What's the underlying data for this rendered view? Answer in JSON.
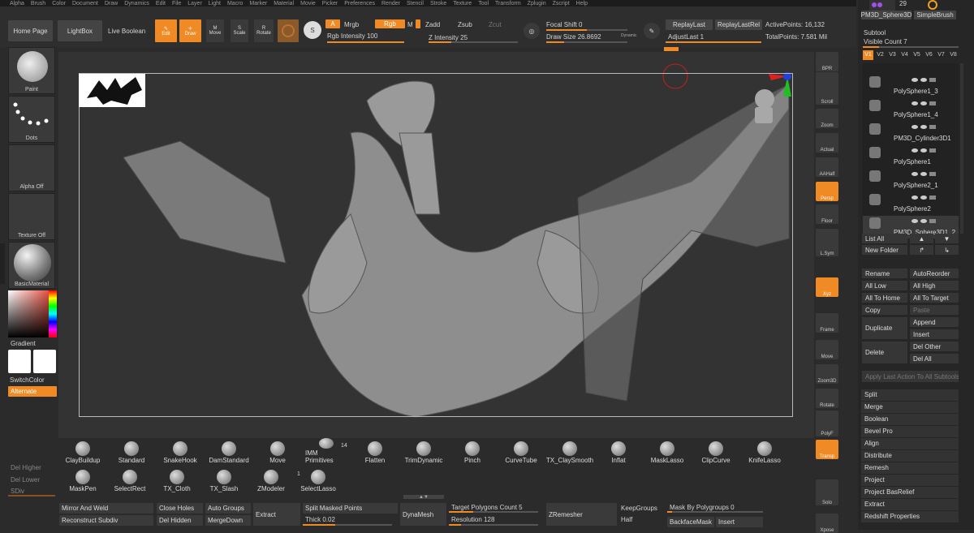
{
  "menu": [
    "Alpha",
    "Brush",
    "Color",
    "Document",
    "Draw",
    "Dynamics",
    "Edit",
    "File",
    "Layer",
    "Light",
    "Macro",
    "Marker",
    "Material",
    "Movie",
    "Picker",
    "Preferences",
    "Render",
    "Stencil",
    "Stroke",
    "Texture",
    "Tool",
    "Transform",
    "Zplugin",
    "Zscript",
    "Help"
  ],
  "top": {
    "home_page": "Home Page",
    "lightbox": "LightBox",
    "live_boolean": "Live Boolean",
    "edit": "Edit",
    "draw": "Draw",
    "move": "Move",
    "scale": "Scale",
    "rotate": "Rotate",
    "a": "A",
    "mrgb": "Mrgb",
    "rgb": "Rgb",
    "m": "M",
    "zadd": "Zadd",
    "zsub": "Zsub",
    "zcut": "Zcut",
    "rgb_intensity_label": "Rgb Intensity",
    "rgb_intensity": "100",
    "z_intensity_label": "Z Intensity",
    "z_intensity": "25",
    "focal_shift_label": "Focal Shift",
    "focal_shift": "0",
    "draw_size_label": "Draw Size",
    "draw_size": "26.8692",
    "dynamic": "Dynamic",
    "replay_last": "ReplayLast",
    "replay_last_rel": "ReplayLastRel",
    "adjust_last_label": "AdjustLast",
    "adjust_last": "1",
    "active_points_label": "ActivePoints:",
    "active_points": "16,132",
    "total_points_label": "TotalPoints:",
    "total_points": "7.581 Mil"
  },
  "left": {
    "paint": "Paint",
    "dots": "Dots",
    "alpha_off": "Alpha Off",
    "texture_off": "Texture Off",
    "basic_material": "BasicMaterial",
    "gradient": "Gradient",
    "switch_color": "SwitchColor",
    "alternate": "Alternate",
    "del_higher": "Del Higher",
    "del_lower": "Del Lower",
    "sdiv": "SDiv"
  },
  "right_strip": [
    "BPR",
    "SPix 3",
    "Scroll",
    "Zoom",
    "Actual",
    "AAHalf",
    "Persp",
    "Floor",
    "Dynamic",
    "L.Sym",
    "Xyz",
    "Frame",
    "Move",
    "Zoom3D",
    "Rotate",
    "Line Fill",
    "PolyF",
    "Transp",
    "Dynamic",
    "Solo",
    "Xpose"
  ],
  "rpanel": {
    "top_count": "29",
    "top_tool": "PM3D_Sphere3D",
    "top_brush": "SimpleBrush",
    "subtool": "Subtool",
    "visible_count_label": "Visible Count",
    "visible_count": "7",
    "versions": [
      "V1",
      "V2",
      "V3",
      "V4",
      "V5",
      "V6",
      "V7",
      "V8"
    ],
    "subtools": [
      "PolySphere1_3",
      "PolySphere1_4",
      "PM3D_Cylinder3D1",
      "PolySphere1",
      "PolySphere2_1",
      "PolySphere2",
      "PM3D_Sphere3D1_2"
    ],
    "list_all": "List All",
    "new_folder": "New Folder",
    "rename": "Rename",
    "auto_reorder": "AutoReorder",
    "all_low": "All Low",
    "all_high": "All High",
    "all_to_home": "All To Home",
    "all_to_target": "All To Target",
    "copy": "Copy",
    "paste": "Paste",
    "duplicate": "Duplicate",
    "append": "Append",
    "insert": "Insert",
    "delete": "Delete",
    "del_other": "Del Other",
    "del_all": "Del All",
    "apply_last": "Apply Last Action To All Subtools",
    "menu": [
      "Split",
      "Merge",
      "Boolean",
      "Bevel Pro",
      "Align",
      "Distribute",
      "Remesh",
      "Project",
      "Project BasRelief",
      "Extract",
      "Redshift Properties"
    ]
  },
  "brushes_row1": [
    "ClayBuildup",
    "Standard",
    "SnakeHook",
    "DamStandard",
    "Move",
    "IMM Primitives",
    "Flatten",
    "TrimDynamic",
    "Pinch",
    "CurveTube",
    "TX_ClaySmooth",
    "Inflat",
    "MaskLasso",
    "ClipCurve",
    "KnifeLasso"
  ],
  "imm_count": "14",
  "brushes_row2": [
    "MaskPen",
    "SelectRect",
    "TX_Cloth",
    "TX_Slash",
    "ZModeler",
    "SelectLasso"
  ],
  "zmodeler_count": "1",
  "bottom": {
    "mirror_weld": "Mirror And Weld",
    "reconstruct": "Reconstruct Subdiv",
    "close_holes": "Close Holes",
    "del_hidden": "Del Hidden",
    "auto_groups": "Auto Groups",
    "merge_down": "MergeDown",
    "extract": "Extract",
    "split_masked": "Split Masked Points",
    "thick_label": "Thick",
    "thick": "0.02",
    "dynamesh": "DynaMesh",
    "target_poly_label": "Target Polygons Count",
    "target_poly": "5",
    "resolution_label": "Resolution",
    "resolution": "128",
    "zremesher": "ZRemesher",
    "keep_groups": "KeepGroups",
    "half": "Half",
    "mask_by_poly_label": "Mask By Polygroups",
    "mask_by_poly": "0",
    "backface_mask": "BackfaceMask",
    "insert": "Insert"
  },
  "colors": {
    "accent": "#f08a24",
    "bg": "#2b2b2b",
    "viewport": "#333333"
  }
}
